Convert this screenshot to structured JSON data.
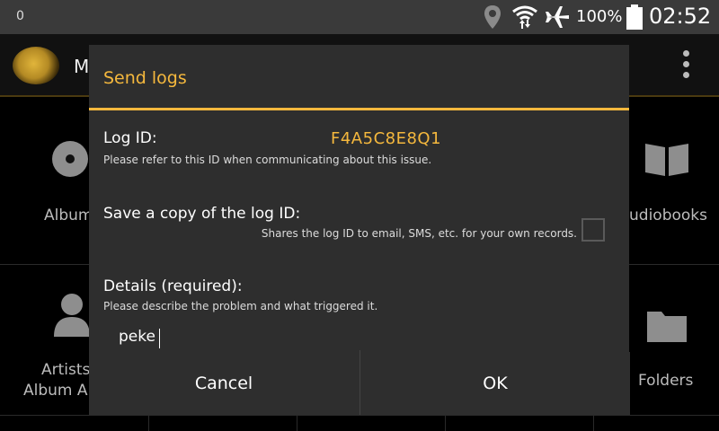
{
  "status_bar": {
    "left_text": "0",
    "icons": [
      "location-icon",
      "wifi-icon",
      "airplane-mode-icon",
      "battery-icon"
    ],
    "battery_percent": "100%",
    "time": "02:52"
  },
  "background_app": {
    "title": "M",
    "grid_labels": {
      "albums": "Album",
      "audiobooks": "udiobooks",
      "artists": "Artists",
      "album_artists": "Album A",
      "folders": "Folders"
    }
  },
  "dialog": {
    "title": "Send logs",
    "log_id_label": "Log ID:",
    "log_id_value": "F4A5C8E8Q1",
    "log_id_hint": "Please refer to this ID when communicating about this issue.",
    "save_copy_label": "Save a copy of the log ID:",
    "save_copy_hint": "Shares the log ID to email, SMS, etc. for your own records.",
    "save_copy_checked": false,
    "details_label": "Details (required):",
    "details_hint": "Please describe the problem and what triggered it.",
    "details_value": "peke",
    "cancel_label": "Cancel",
    "ok_label": "OK"
  },
  "colors": {
    "accent": "#f5b83d",
    "dialog_bg": "#2e2e2e",
    "status_bar_bg": "#3a3a3a"
  }
}
